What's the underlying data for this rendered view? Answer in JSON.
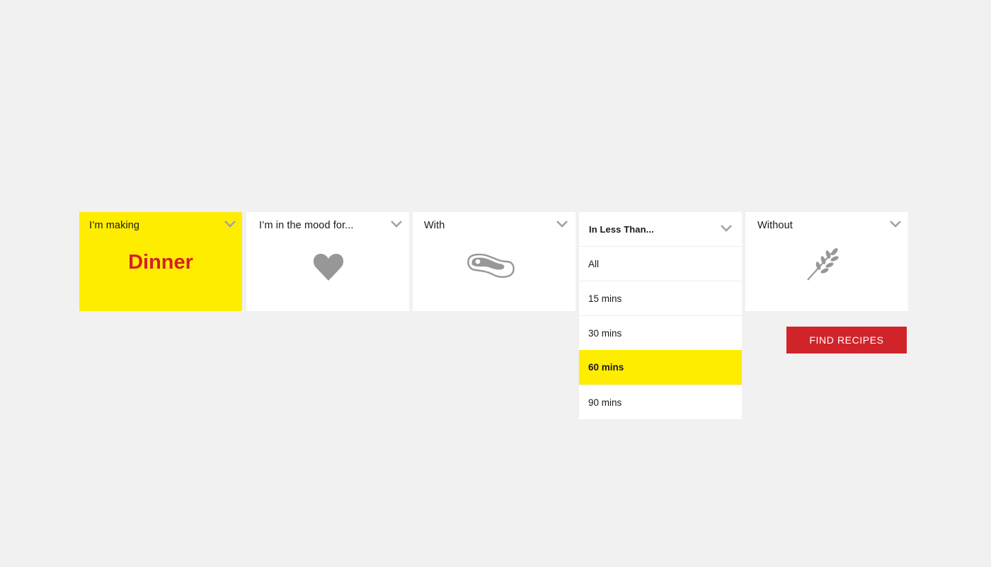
{
  "filters": {
    "making": {
      "label": "I’m making",
      "value": "Dinner",
      "icon": "chevron-down-icon"
    },
    "mood": {
      "label": "I’m in the mood for...",
      "icon": "heart-icon"
    },
    "with": {
      "label": "With",
      "icon": "steak-icon"
    },
    "time": {
      "label": "In Less Than...",
      "options": [
        "All",
        "15 mins",
        "30 mins",
        "60 mins",
        "90 mins"
      ],
      "selected": "60 mins"
    },
    "without": {
      "label": "Without",
      "icon": "wheat-icon"
    }
  },
  "actions": {
    "find_label": "FIND RECIPES"
  },
  "colors": {
    "background": "#f1f1f1",
    "card": "#ffffff",
    "highlight": "#ffed00",
    "accent_red": "#d42027",
    "button_red": "#d1232a",
    "icon_gray": "#979797"
  }
}
